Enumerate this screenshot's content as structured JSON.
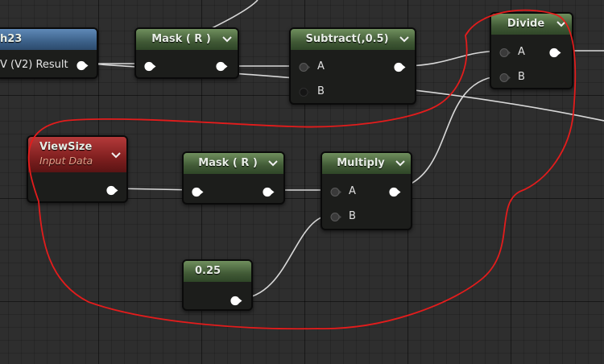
{
  "graph": {
    "nodes": {
      "texcoord": {
        "title": "h23",
        "pin_label": "V (V2) Result"
      },
      "mask_top": {
        "title": "Mask ( R )"
      },
      "subtract": {
        "title": "Subtract(,0.5)",
        "pin_a": "A",
        "pin_b": "B"
      },
      "divide": {
        "title": "Divide",
        "pin_a": "A",
        "pin_b": "B"
      },
      "viewsize": {
        "title": "ViewSize",
        "subtitle": "Input Data"
      },
      "mask_bottom": {
        "title": "Mask ( R )"
      },
      "multiply": {
        "title": "Multiply",
        "pin_a": "A",
        "pin_b": "B"
      },
      "constant": {
        "title": "0.25"
      }
    },
    "colors": {
      "wire": "#d8d8d8",
      "annotation": "#e31c1c",
      "header_green": "#4d6b3f",
      "header_red": "#8b2020",
      "header_blue": "#3f6690",
      "node_body": "#1c1d1b"
    },
    "icons": [
      "chevron-down-icon",
      "pin-connected-icon",
      "pin-disconnected-icon"
    ]
  }
}
